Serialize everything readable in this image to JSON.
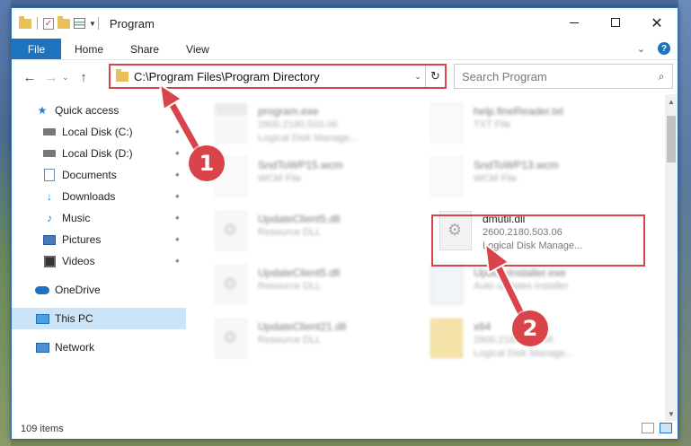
{
  "window": {
    "title": "Program",
    "controls": {
      "minimize": "—",
      "maximize": "☐",
      "close": "✕"
    }
  },
  "ribbon": {
    "tabs": [
      "File",
      "Home",
      "Share",
      "View"
    ],
    "expand_glyph": "⌄",
    "help_glyph": "?"
  },
  "address": {
    "path": "C:\\Program Files\\Program Directory",
    "dropdown_glyph": "⌄",
    "refresh_glyph": "↻"
  },
  "search": {
    "placeholder": "Search Program",
    "icon_glyph": "⌕"
  },
  "nav": {
    "back": "←",
    "forward": "→",
    "recent": "⌄",
    "up": "↑"
  },
  "sidebar": {
    "quick_access": "Quick access",
    "items": [
      {
        "label": "Local Disk (C:)",
        "pinned": true
      },
      {
        "label": "Local Disk (D:)",
        "pinned": true
      },
      {
        "label": "Documents",
        "pinned": true
      },
      {
        "label": "Downloads",
        "pinned": true
      },
      {
        "label": "Music",
        "pinned": true
      },
      {
        "label": "Pictures",
        "pinned": true
      },
      {
        "label": "Videos",
        "pinned": true
      }
    ],
    "onedrive": "OneDrive",
    "this_pc": "This PC",
    "network": "Network",
    "pin_glyph": "📌"
  },
  "files": [
    {
      "name": "program.exe",
      "line2": "2600.2180.503.06",
      "line3": "Logical Disk Manage...",
      "kind": "exe",
      "blurred": true
    },
    {
      "name": "help.fineReader.txt",
      "line2": "TXT File",
      "line3": "",
      "kind": "blank",
      "blurred": true
    },
    {
      "name": "SndToWP15.wcm",
      "line2": "WCM File",
      "line3": "",
      "kind": "blank",
      "blurred": true
    },
    {
      "name": "SndToWP13.wcm",
      "line2": "WCM File",
      "line3": "",
      "kind": "blank",
      "blurred": true
    },
    {
      "name": "UpdateClient5.dll",
      "line2": "Resource DLL",
      "line3": "",
      "kind": "dll",
      "blurred": true
    },
    {
      "name": "dmutil.dll",
      "line2": "2600.2180.503.06",
      "line3": "Logical Disk Manage...",
      "kind": "dll",
      "blurred": false
    },
    {
      "name": "UpdateClient5.dll",
      "line2": "Resource DLL",
      "line3": "",
      "kind": "dll",
      "blurred": true
    },
    {
      "name": "UpdateInstaller.exe",
      "line2": "Auto updates installer",
      "line3": "",
      "kind": "inst",
      "blurred": true
    },
    {
      "name": "UpdateClient21.dll",
      "line2": "Resource DLL",
      "line3": "",
      "kind": "dll",
      "blurred": true
    },
    {
      "name": "x64",
      "line2": "2600.2180.503.06",
      "line3": "Logical Disk Manage...",
      "kind": "folder",
      "blurred": true
    }
  ],
  "status": {
    "item_count": "109 items"
  },
  "callouts": {
    "one": "1",
    "two": "2"
  },
  "colors": {
    "accent": "#1e73be",
    "highlight": "#d9444b",
    "selection": "#cce4f7"
  }
}
